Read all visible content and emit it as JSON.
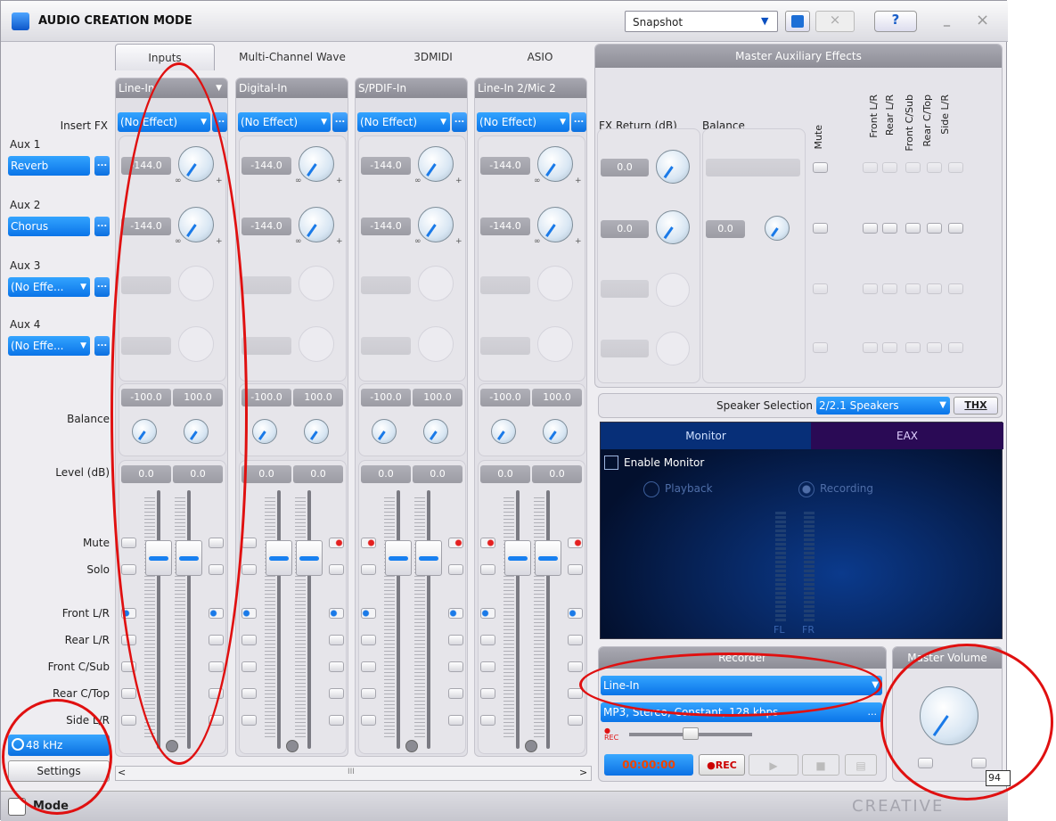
{
  "window": {
    "title": "AUDIO CREATION MODE",
    "snapshot_value": "Snapshot",
    "help_label": "?",
    "minimize_label": "_",
    "close_label": "×"
  },
  "tabs": [
    "Inputs",
    "Multi-Channel Wave",
    "3DMIDI",
    "ASIO"
  ],
  "left": {
    "insert_fx": "Insert FX",
    "aux": [
      {
        "label": "Aux 1",
        "value": "Reverb"
      },
      {
        "label": "Aux 2",
        "value": "Chorus"
      },
      {
        "label": "Aux 3",
        "value": "(No Effe..."
      },
      {
        "label": "Aux 4",
        "value": "(No Effe..."
      }
    ],
    "balance": "Balance",
    "level": "Level (dB)",
    "mute": "Mute",
    "solo": "Solo",
    "routes": [
      "Front L/R",
      "Rear L/R",
      "Front C/Sub",
      "Rear C/Top",
      "Side L/R"
    ],
    "sample_rate": "48 kHz",
    "settings": "Settings",
    "dots": "..."
  },
  "strips": [
    {
      "name": "Line-In",
      "fx": "(No Effect)",
      "aux1": "-144.0",
      "aux2": "-144.0",
      "bal_l": "-100.0",
      "bal_r": "100.0",
      "lvl_l": "0.0",
      "lvl_r": "0.0"
    },
    {
      "name": "Digital-In",
      "fx": "(No Effect)",
      "aux1": "-144.0",
      "aux2": "-144.0",
      "bal_l": "-100.0",
      "bal_r": "100.0",
      "lvl_l": "0.0",
      "lvl_r": "0.0"
    },
    {
      "name": "S/PDIF-In",
      "fx": "(No Effect)",
      "aux1": "-144.0",
      "aux2": "-144.0",
      "bal_l": "-100.0",
      "bal_r": "100.0",
      "lvl_l": "0.0",
      "lvl_r": "0.0"
    },
    {
      "name": "Line-In 2/Mic 2",
      "fx": "(No Effect)",
      "aux1": "-144.0",
      "aux2": "-144.0",
      "bal_l": "-100.0",
      "bal_r": "100.0",
      "lvl_l": "0.0",
      "lvl_r": "0.0"
    }
  ],
  "knob_marks": {
    "inf": "∞",
    "plus": "+"
  },
  "master_aux": {
    "title": "Master Auxiliary Effects",
    "fx_return": "FX Return (dB)",
    "balance": "Balance",
    "mute": "Mute",
    "routes": [
      "Front L/R",
      "Rear L/R",
      "Front C/Sub",
      "Rear C/Top",
      "Side L/R"
    ],
    "ret1": "0.0",
    "ret2": "0.0",
    "bal2": "0.0"
  },
  "speaker": {
    "label": "Speaker Selection",
    "value": "2/2.1 Speakers",
    "thx": "THX"
  },
  "monitor": {
    "tab_monitor": "Monitor",
    "tab_eax": "EAX",
    "enable": "Enable Monitor",
    "playback": "Playback",
    "recording": "Recording",
    "fl": "FL",
    "fr": "FR"
  },
  "recorder": {
    "title": "Recorder",
    "source": "Line-In",
    "format": "MP3, Stereo, Constant, 128 kbps",
    "rec_small": "REC",
    "time": "00:00:00",
    "rec_button": "●REC"
  },
  "master_volume": {
    "title": "Master Volume",
    "tooltip": "94"
  },
  "footer": {
    "mode": "Mode",
    "brand": "CREATIVE",
    "scroll_mark": "III"
  }
}
